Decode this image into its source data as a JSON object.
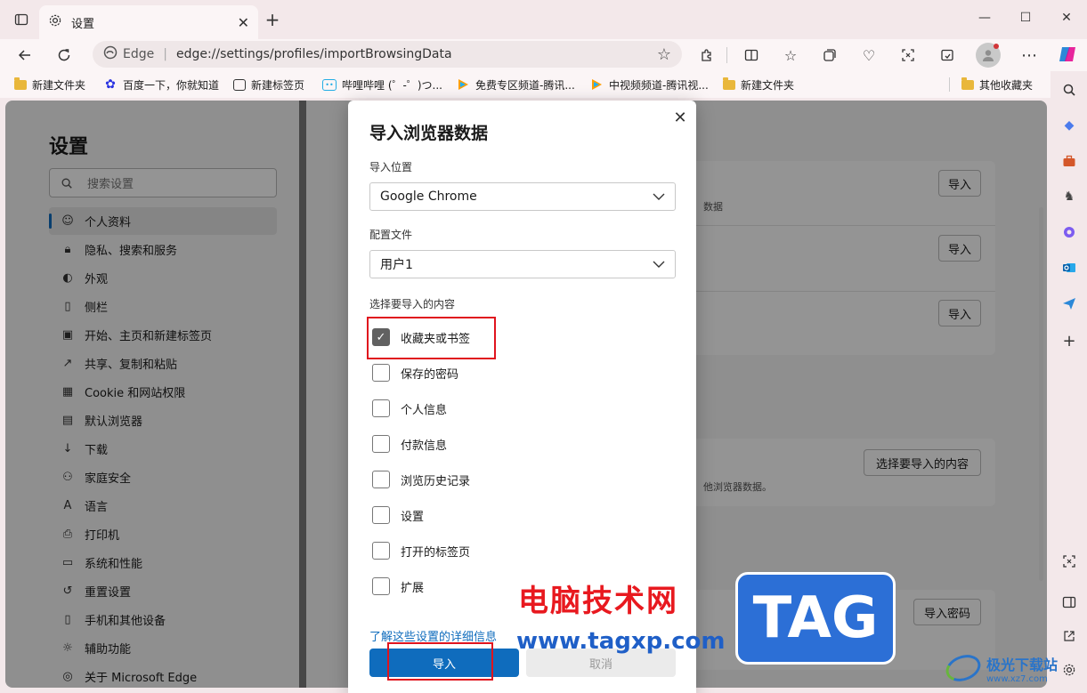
{
  "window": {
    "tab_title": "设置",
    "tab_icon": "gear-icon",
    "minimize": "—",
    "maximize": "☐",
    "close": "✕"
  },
  "toolbar": {
    "address_brand": "Edge",
    "address_url": "edge://settings/profiles/importBrowsingData"
  },
  "favorites": [
    {
      "label": "新建文件夹",
      "icon": "folder-icon"
    },
    {
      "label": "百度一下，你就知道",
      "icon": "baidu-icon"
    },
    {
      "label": "新建标签页",
      "icon": "newtab-icon"
    },
    {
      "label": "哔哩哔哩 (゜-゜)つ...",
      "icon": "bilibili-icon"
    },
    {
      "label": "免费专区频道-腾讯...",
      "icon": "tencent-video-icon"
    },
    {
      "label": "中视频频道-腾讯视...",
      "icon": "tencent-video-icon"
    },
    {
      "label": "新建文件夹",
      "icon": "folder-icon"
    },
    {
      "label": "其他收藏夹",
      "icon": "folder-icon"
    }
  ],
  "settings": {
    "title": "设置",
    "search_placeholder": "搜索设置",
    "nav": [
      {
        "label": "个人资料",
        "icon": "profile-icon",
        "selected": true
      },
      {
        "label": "隐私、搜索和服务",
        "icon": "lock-icon"
      },
      {
        "label": "外观",
        "icon": "palette-icon"
      },
      {
        "label": "侧栏",
        "icon": "sidebar-icon"
      },
      {
        "label": "开始、主页和新建标签页",
        "icon": "home-icon"
      },
      {
        "label": "共享、复制和粘贴",
        "icon": "share-icon"
      },
      {
        "label": "Cookie 和网站权限",
        "icon": "cookie-icon"
      },
      {
        "label": "默认浏览器",
        "icon": "browser-icon"
      },
      {
        "label": "下载",
        "icon": "download-icon"
      },
      {
        "label": "家庭安全",
        "icon": "family-icon"
      },
      {
        "label": "语言",
        "icon": "language-icon"
      },
      {
        "label": "打印机",
        "icon": "printer-icon"
      },
      {
        "label": "系统和性能",
        "icon": "system-icon"
      },
      {
        "label": "重置设置",
        "icon": "reset-icon"
      },
      {
        "label": "手机和其他设备",
        "icon": "phone-icon"
      },
      {
        "label": "辅助功能",
        "icon": "accessibility-icon"
      },
      {
        "label": "关于 Microsoft Edge",
        "icon": "edge-icon"
      }
    ],
    "bg": {
      "import_label": "导入",
      "row_fragment_1": "数据",
      "choose_button": "选择要导入的内容",
      "row_fragment_2": "他浏览器数据。",
      "import_password": "导入密码"
    }
  },
  "dialog": {
    "title": "导入浏览器数据",
    "import_from_label": "导入位置",
    "import_from_value": "Google Chrome",
    "profile_label": "配置文件",
    "profile_value": "用户1",
    "choose_label": "选择要导入的内容",
    "items": [
      {
        "label": "收藏夹或书签",
        "checked": true
      },
      {
        "label": "保存的密码",
        "checked": false
      },
      {
        "label": "个人信息",
        "checked": false
      },
      {
        "label": "付款信息",
        "checked": false
      },
      {
        "label": "浏览历史记录",
        "checked": false
      },
      {
        "label": "设置",
        "checked": false
      },
      {
        "label": "打开的标签页",
        "checked": false
      },
      {
        "label": "扩展",
        "checked": false
      }
    ],
    "learn_more": "了解这些设置的详细信息",
    "import_button": "导入",
    "cancel_button": "取消"
  },
  "watermark": {
    "site_cn": "电脑技术网",
    "site_url": "www.tagxp.com",
    "tag": "TAG",
    "logo_cn": "极光下载站",
    "logo_url": "www.xz7.com"
  },
  "colors": {
    "accent": "#0f6cbd",
    "highlight": "#e0141e"
  }
}
